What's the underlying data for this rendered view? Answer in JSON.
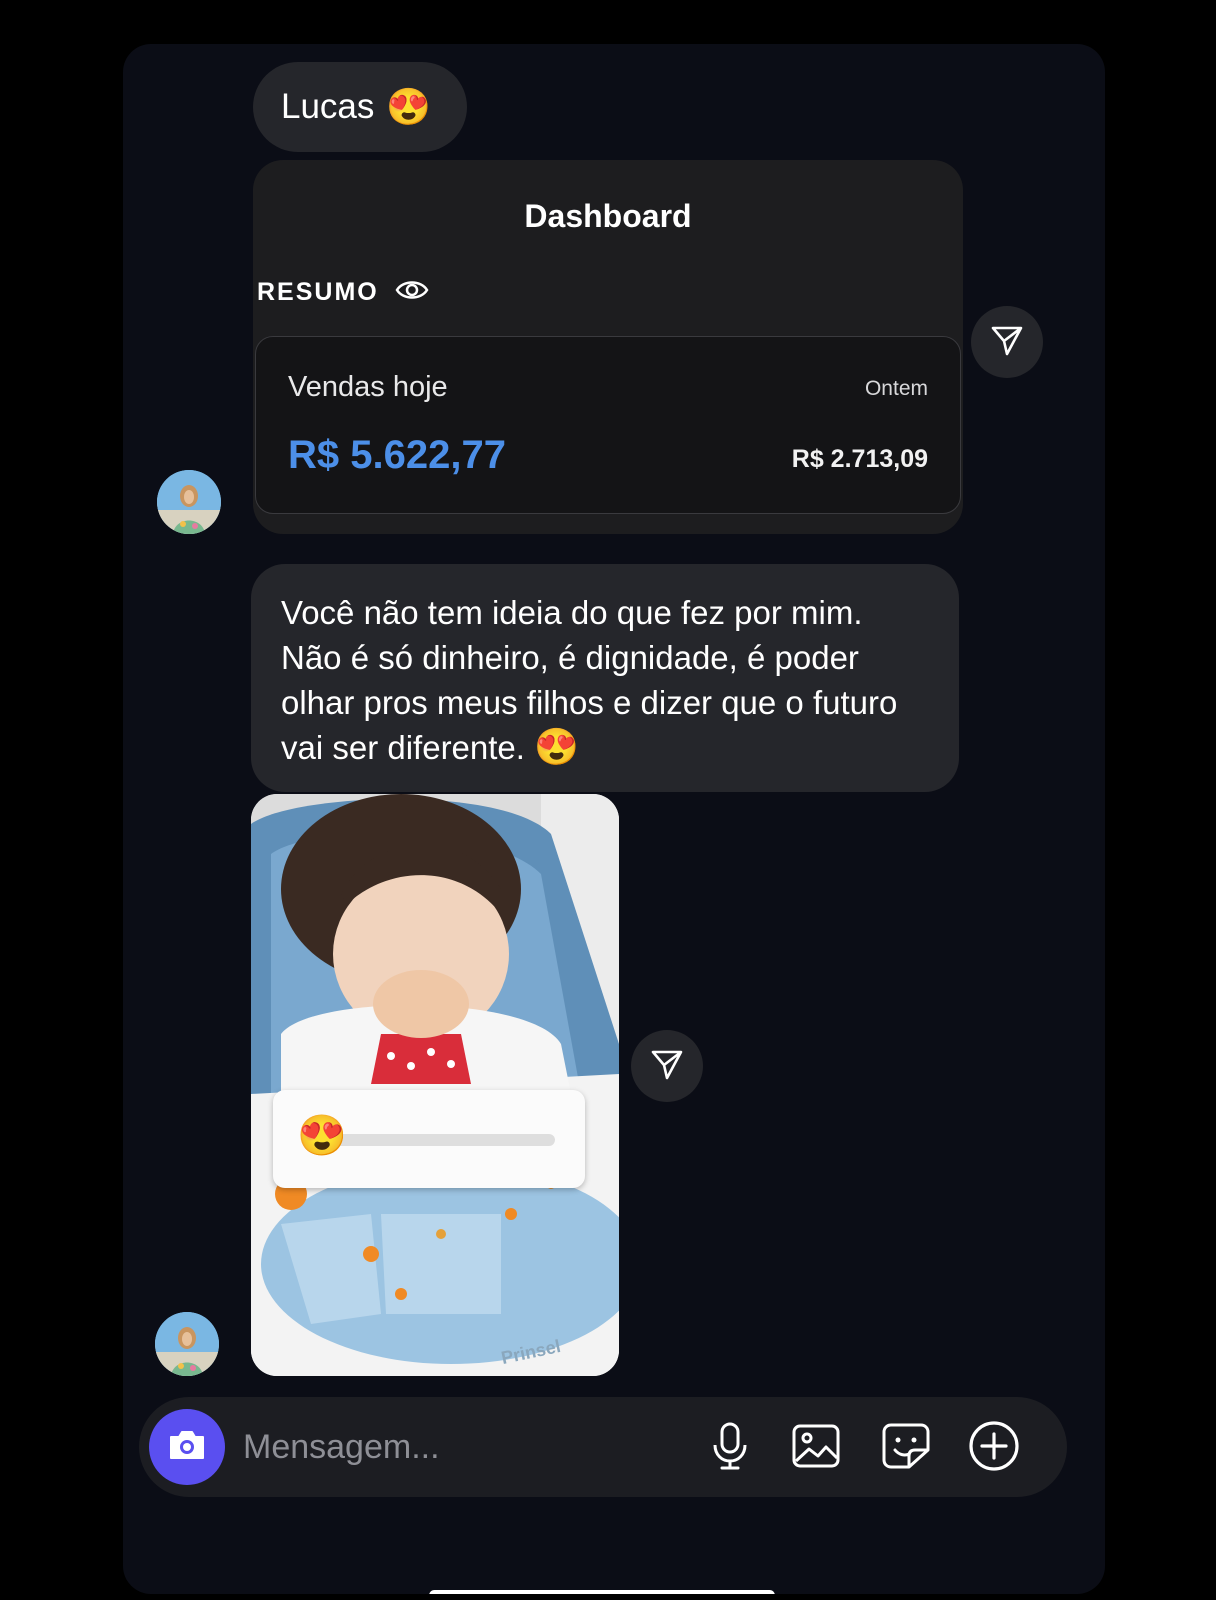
{
  "messages": {
    "first": {
      "text": "Lucas",
      "emoji": "😍"
    },
    "dashboard": {
      "title": "Dashboard",
      "section_label": "RESUMO",
      "sales_today_label": "Vendas hoje",
      "yesterday_label": "Ontem",
      "sales_today_value": "R$ 5.622,77",
      "yesterday_value": "R$ 2.713,09"
    },
    "second": {
      "text": "Você não tem ideia do que fez por mim. Não é só dinheiro, é dignidade, é poder olhar pros meus filhos e dizer que o futuro vai ser diferente.",
      "emoji": "😍"
    },
    "photo": {
      "brand_text": "Prinsel",
      "slider_emoji": "😍",
      "slider_value": 0
    }
  },
  "composer": {
    "placeholder": "Mensagem..."
  },
  "icons": {
    "share": "paper-plane-icon",
    "eye": "eye-icon",
    "camera": "camera-icon",
    "mic": "microphone-icon",
    "gallery": "image-icon",
    "sticker": "sticker-icon",
    "plus": "plus-circle-icon"
  },
  "colors": {
    "background": "#0b0d16",
    "bubble": "#25262b",
    "accent_blue": "#4c8fe8",
    "camera_button": "#5a4ff0"
  }
}
